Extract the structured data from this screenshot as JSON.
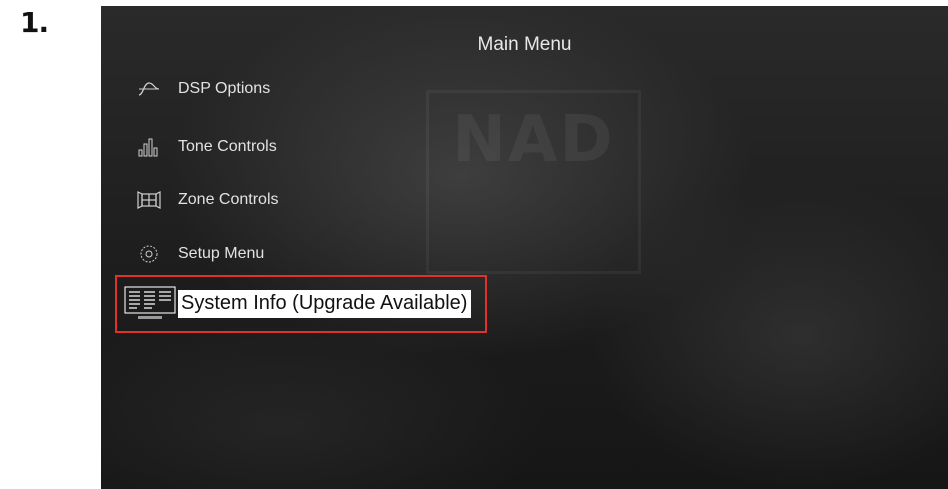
{
  "step_number": "1.",
  "screen": {
    "title": "Main Menu",
    "watermark": "NAD"
  },
  "menu": {
    "items": [
      {
        "label": "DSP Options",
        "icon": "waveform-icon"
      },
      {
        "label": "Tone Controls",
        "icon": "equalizer-icon"
      },
      {
        "label": "Zone Controls",
        "icon": "zone-icon"
      },
      {
        "label": "Setup Menu",
        "icon": "gear-icon"
      },
      {
        "label": "System Info (Upgrade Available)",
        "icon": "system-info-icon",
        "selected": true
      }
    ]
  },
  "colors": {
    "highlight_border": "#e0312b",
    "screen_background": "#1f1f1f",
    "menu_text": "#e2e2e2"
  }
}
